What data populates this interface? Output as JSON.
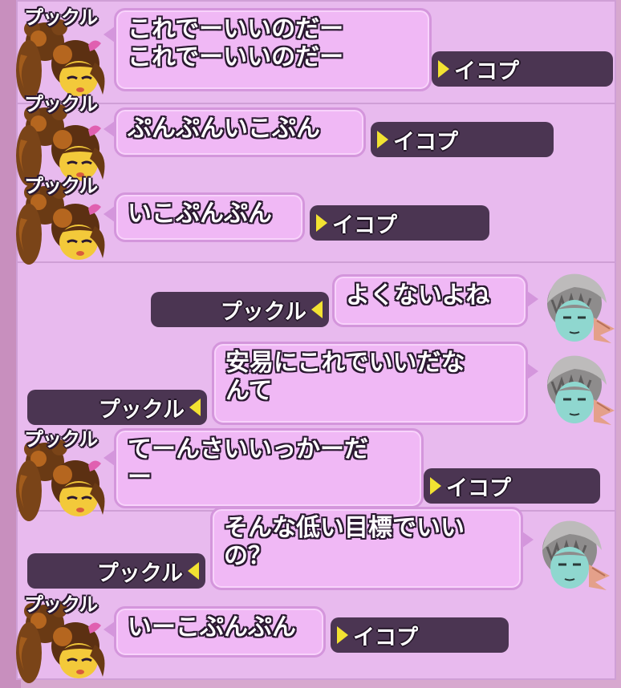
{
  "chat": {
    "messages": [
      {
        "side": "left",
        "speaker": "プックル",
        "text": "これでーいいのだー\nこれでーいいのだー",
        "tag": "イコプ"
      },
      {
        "side": "left",
        "speaker": "プックル",
        "text": "ぷんぷんいこぷん",
        "tag": "イコプ"
      },
      {
        "side": "left",
        "speaker": "プックル",
        "text": "いこぷんぷん",
        "tag": "イコプ"
      },
      {
        "side": "right",
        "text": "よくないよね",
        "tag": "プックル"
      },
      {
        "side": "right",
        "text": "安易にこれでいいだな\nんて",
        "tag": "プックル"
      },
      {
        "side": "left",
        "speaker": "プックル",
        "text": "てーんさいいっかーだ\nー",
        "tag": "イコプ"
      },
      {
        "side": "right",
        "text": "そんな低い目標でいい\nの？",
        "tag": "プックル"
      },
      {
        "side": "left",
        "speaker": "プックル",
        "text": "いーこぷんぷん",
        "tag": "イコプ"
      }
    ]
  },
  "colors": {
    "panel": "#e8baee",
    "bubble": "#f0b8f5",
    "tag_bg": "#4b3552",
    "tag_arrow": "#f2e232"
  },
  "icons": {
    "left_avatar": "lion-hood-girl-avatar-icon",
    "right_avatar": "silver-hair-elf-avatar-icon"
  }
}
